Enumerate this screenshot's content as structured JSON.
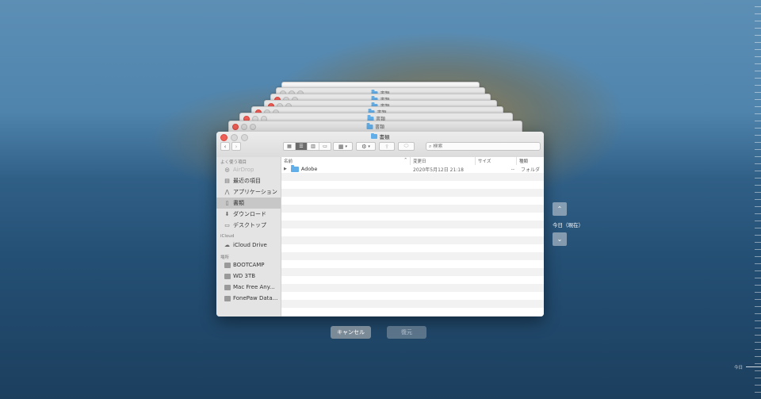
{
  "window": {
    "title": "書類"
  },
  "stacked_windows": [
    {
      "title": "書類"
    },
    {
      "title": "書類"
    },
    {
      "title": "書類"
    },
    {
      "title": "書類"
    },
    {
      "title": "書類"
    },
    {
      "title": "書類"
    }
  ],
  "toolbar": {
    "back": "‹",
    "forward": "›",
    "search_placeholder": "検索"
  },
  "sidebar": {
    "favorites_header": "よく使う項目",
    "favorites": [
      {
        "label": "AirDrop",
        "icon": "airdrop-icon"
      },
      {
        "label": "最近の項目",
        "icon": "recents-icon"
      },
      {
        "label": "アプリケーション",
        "icon": "applications-icon"
      },
      {
        "label": "書類",
        "icon": "documents-icon"
      },
      {
        "label": "ダウンロード",
        "icon": "downloads-icon"
      },
      {
        "label": "デスクトップ",
        "icon": "desktop-icon"
      }
    ],
    "icloud_header": "iCloud",
    "icloud": [
      {
        "label": "iCloud Drive",
        "icon": "cloud-icon"
      }
    ],
    "locations_header": "場所",
    "locations": [
      {
        "label": "BOOTCAMP",
        "icon": "disk-icon"
      },
      {
        "label": "WD 3TB",
        "icon": "disk-icon"
      },
      {
        "label": "Mac Free Any...",
        "icon": "disk-icon"
      },
      {
        "label": "FonePaw Data...",
        "icon": "disk-icon"
      }
    ]
  },
  "columns": {
    "name": "名前",
    "date": "変更日",
    "size": "サイズ",
    "kind": "種類"
  },
  "files": [
    {
      "name": "Adobe",
      "date": "2020年5月12日 21:18",
      "size": "--",
      "kind": "フォルダ"
    }
  ],
  "buttons": {
    "cancel": "キャンセル",
    "restore": "復元"
  },
  "timemachine": {
    "current": "今日（現在）",
    "ruler_label": "今日"
  }
}
